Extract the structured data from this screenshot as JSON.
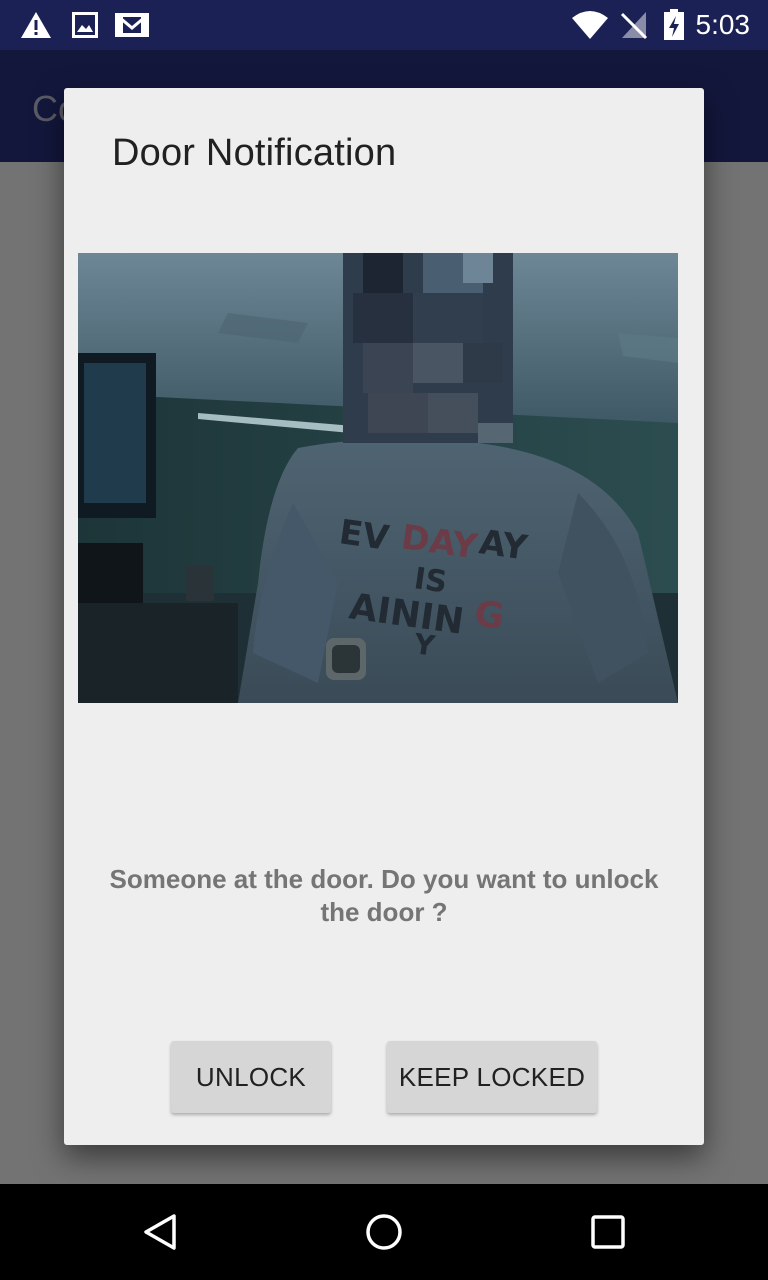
{
  "status_bar": {
    "time": "5:03",
    "icons": [
      "warning-icon",
      "image-icon",
      "gmail-icon",
      "wifi-icon",
      "no-signal-icon",
      "battery-charging-icon"
    ]
  },
  "app_bar": {
    "title": "Co"
  },
  "dialog": {
    "title": "Door Notification",
    "message": "Someone at the door. Do you want to unlock the door ?",
    "unlock_label": "UNLOCK",
    "keep_locked_label": "KEEP LOCKED"
  },
  "nav_bar": {
    "icons": [
      "back-icon",
      "home-icon",
      "recents-icon"
    ]
  },
  "colors": {
    "status_bar": "#1b2154",
    "app_bar": "#2a3385",
    "dialog_bg": "#eeeeee",
    "button_bg": "#d6d6d6"
  }
}
